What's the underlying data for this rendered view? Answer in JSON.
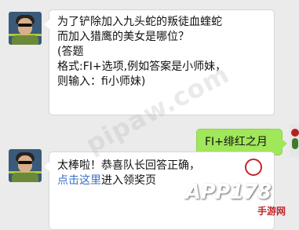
{
  "messages": [
    {
      "sender": "contact",
      "lines": [
        "为了铲除加入九头蛇的叛徒血蝰蛇",
        "而加入猎鹰的美女是哪位？",
        "(答题",
        "格式:FI+选项,例如答案是小师妹，",
        "则输入：fi小师妹)"
      ]
    },
    {
      "sender": "me",
      "text": "FI+绯红之月"
    },
    {
      "sender": "contact",
      "line1": "太棒啦！恭喜队长回答正确，",
      "line2_link": "点击这里",
      "line2_text": "进入领奖页"
    }
  ],
  "watermark": {
    "diagonal": "pipaw.com",
    "logo_text": "APP178",
    "logo_site": "手游网"
  },
  "colors": {
    "background": "#ebebeb",
    "bubble_left": "#ffffff",
    "bubble_right": "#a0e75a",
    "link": "#3b6fc6"
  }
}
